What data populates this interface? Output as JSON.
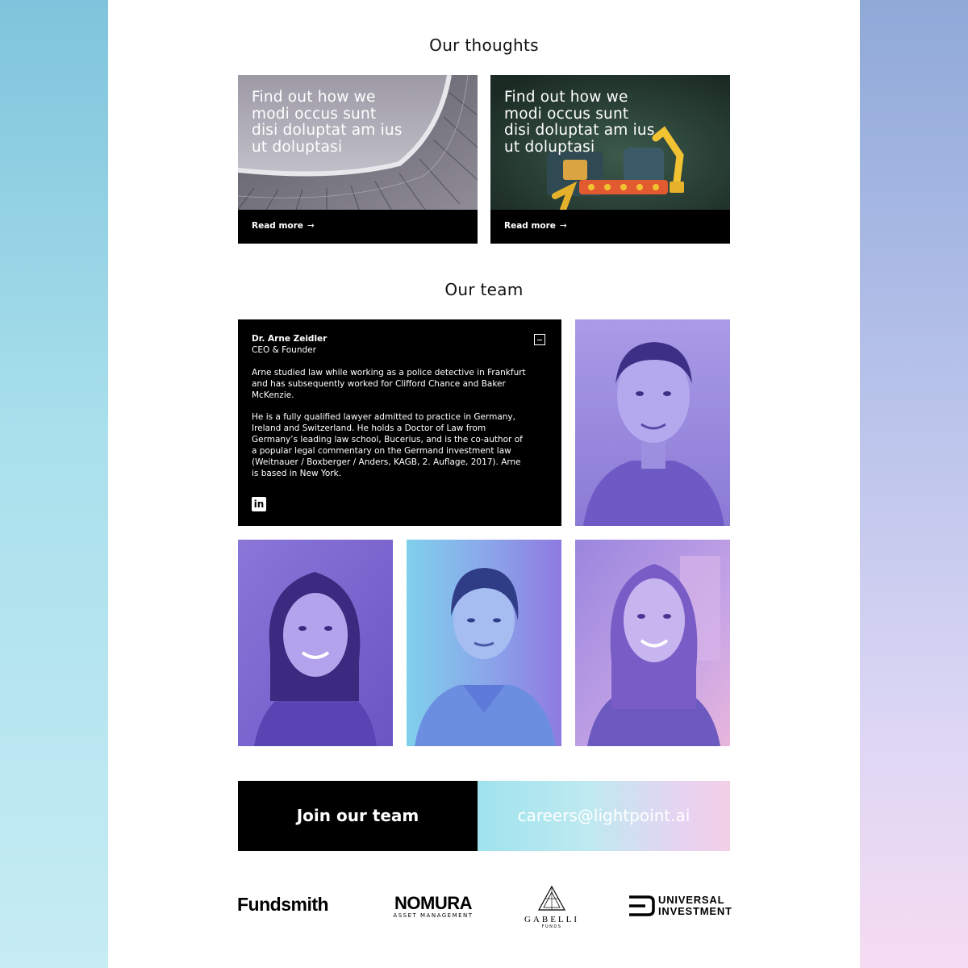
{
  "thoughts": {
    "heading": "Our thoughts",
    "cards": [
      {
        "title": "Find out how we modi occus sunt disi doluptat am ius ut doluptasi",
        "read_more": "Read more",
        "image": "stadium-roof"
      },
      {
        "title": "Find out how we modi occus sunt disi doluptat am ius ut doluptasi",
        "read_more": "Read more",
        "image": "robot-factory"
      }
    ]
  },
  "team": {
    "heading": "Our team",
    "featured": {
      "name": "Dr. Arne Zeidler",
      "role": "CEO & Founder",
      "paragraphs": [
        "Arne studied law while working as a police detective in Frankfurt and has subsequently worked for Clifford Chance and Baker McKenzie.",
        "He is a fully qualified lawyer admitted to practice in Germany, Ireland and Switzerland. He holds a Doctor of Law from Germany’s leading law school, Bucerius, and is the co-author of a popular legal commentary on the Germand investment law (Weitnauer / Boxberger / Anders, KAGB, 2. Auflage, 2017). Arne is based in New York."
      ],
      "linkedin_icon": "linkedin-icon",
      "linkedin_glyph": "in",
      "collapse_icon": "minus-icon"
    }
  },
  "careers": {
    "join_label": "Join our team",
    "email": "careers@lightpoint.ai"
  },
  "partners": {
    "fundsmith": "Fundsmith",
    "nomura_main": "NOMURA",
    "nomura_sub": "ASSET MANAGEMENT",
    "gabelli_main": "GABELLI",
    "gabelli_sub": "FUNDS",
    "universal_line1": "UNIVERSAL",
    "universal_line2": "INVESTMENT"
  },
  "colors": {
    "black": "#000000",
    "photo_tint": "#7b63d6",
    "background_left": "#a9e0ec",
    "background_right": "#b7c2ea"
  }
}
